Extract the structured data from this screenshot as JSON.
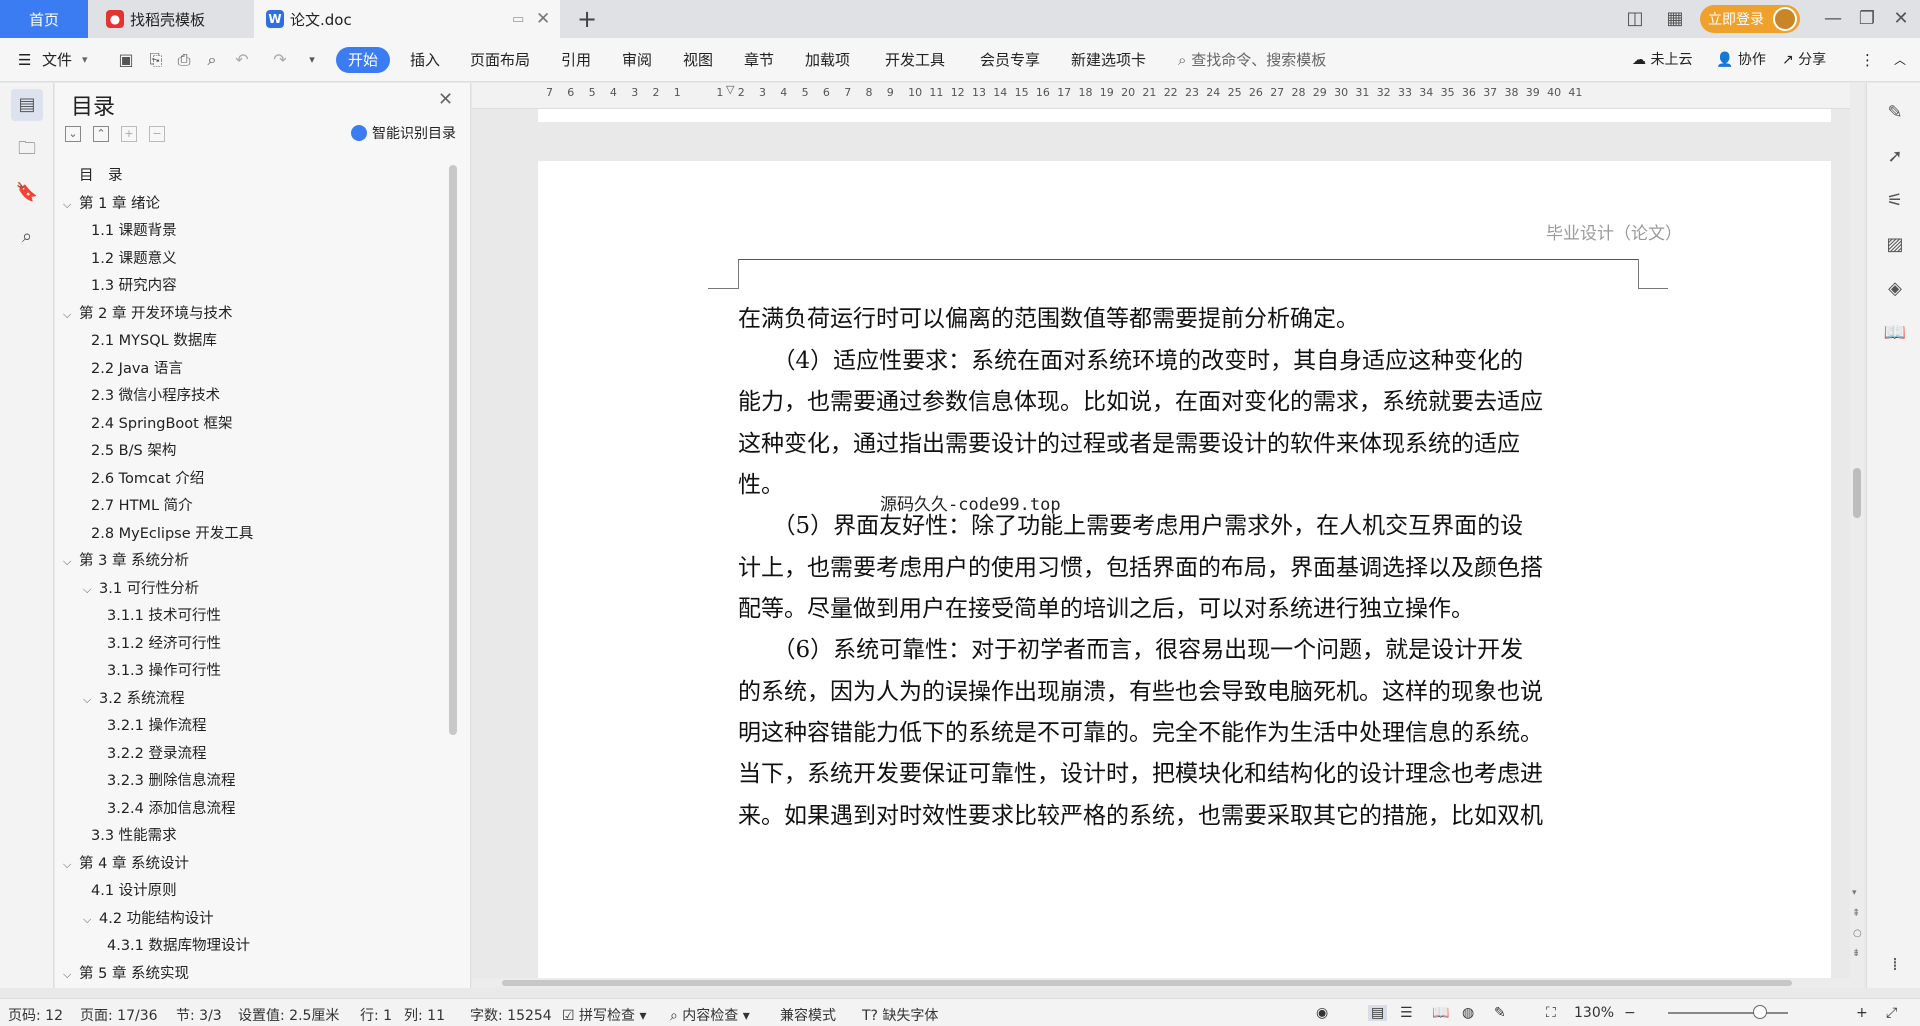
{
  "tabs": {
    "home": "首页",
    "template": "找稻壳模板",
    "document": "论文.doc",
    "add": "+"
  },
  "titlebar": {
    "login": "立即登录"
  },
  "toolbar": {
    "file": "文件",
    "items": [
      "开始",
      "插入",
      "页面布局",
      "引用",
      "审阅",
      "视图",
      "章节",
      "加载项",
      "开发工具",
      "会员专享",
      "新建选项卡"
    ],
    "search_placeholder": "查找命令、搜索模板",
    "cloud": "未上云",
    "collab": "协作",
    "share": "分享"
  },
  "toc": {
    "title": "目录",
    "ai_label": "智能识别目录",
    "items": [
      {
        "label": "目　录",
        "level": 0,
        "caret": ""
      },
      {
        "label": "第 1 章  绪论",
        "level": 0,
        "caret": "v"
      },
      {
        "label": "1.1  课题背景",
        "level": 1,
        "caret": ""
      },
      {
        "label": "1.2  课题意义",
        "level": 1,
        "caret": ""
      },
      {
        "label": "1.3  研究内容",
        "level": 1,
        "caret": ""
      },
      {
        "label": "第 2 章  开发环境与技术",
        "level": 0,
        "caret": "v"
      },
      {
        "label": "2.1 MYSQL 数据库",
        "level": 1,
        "caret": ""
      },
      {
        "label": "2.2 Java 语言",
        "level": 1,
        "caret": ""
      },
      {
        "label": "2.3  微信小程序技术",
        "level": 1,
        "caret": ""
      },
      {
        "label": "2.4 SpringBoot 框架",
        "level": 1,
        "caret": ""
      },
      {
        "label": "2.5 B/S 架构",
        "level": 1,
        "caret": ""
      },
      {
        "label": "2.6 Tomcat  介绍",
        "level": 1,
        "caret": ""
      },
      {
        "label": "2.7 HTML 简介",
        "level": 1,
        "caret": ""
      },
      {
        "label": "2.8 MyEclipse 开发工具",
        "level": 1,
        "caret": ""
      },
      {
        "label": "第 3 章  系统分析",
        "level": 0,
        "caret": "v"
      },
      {
        "label": "3.1  可行性分析",
        "level": 1,
        "caret": "v"
      },
      {
        "label": "3.1.1  技术可行性",
        "level": 2,
        "caret": ""
      },
      {
        "label": "3.1.2  经济可行性",
        "level": 2,
        "caret": ""
      },
      {
        "label": "3.1.3  操作可行性",
        "level": 2,
        "caret": ""
      },
      {
        "label": "3.2  系统流程",
        "level": 1,
        "caret": "v"
      },
      {
        "label": "3.2.1  操作流程",
        "level": 2,
        "caret": ""
      },
      {
        "label": "3.2.2  登录流程",
        "level": 2,
        "caret": ""
      },
      {
        "label": "3.2.3  删除信息流程",
        "level": 2,
        "caret": ""
      },
      {
        "label": "3.2.4  添加信息流程",
        "level": 2,
        "caret": ""
      },
      {
        "label": "3.3  性能需求",
        "level": 1,
        "caret": ""
      },
      {
        "label": "第 4 章  系统设计",
        "level": 0,
        "caret": "v"
      },
      {
        "label": "4.1  设计原则",
        "level": 1,
        "caret": ""
      },
      {
        "label": "4.2  功能结构设计",
        "level": 1,
        "caret": "v"
      },
      {
        "label": "4.3.1  数据库物理设计",
        "level": 2,
        "caret": ""
      },
      {
        "label": "第 5 章  系统实现",
        "level": 0,
        "caret": "v"
      }
    ]
  },
  "ruler": {
    "numbers": [
      "7",
      "6",
      "5",
      "4",
      "3",
      "2",
      "1",
      "",
      "1",
      "2",
      "3",
      "4",
      "5",
      "6",
      "7",
      "8",
      "9",
      "10",
      "11",
      "12",
      "13",
      "14",
      "15",
      "16",
      "17",
      "18",
      "19",
      "20",
      "21",
      "22",
      "23",
      "24",
      "25",
      "26",
      "27",
      "28",
      "29",
      "30",
      "31",
      "32",
      "33",
      "34",
      "35",
      "36",
      "37",
      "38",
      "39",
      "40",
      "41"
    ]
  },
  "document": {
    "header": "毕业设计（论文）",
    "watermark": "源码久久-code99.top",
    "lines": [
      "在满负荷运行时可以偏离的范围数值等都需要提前分析确定。",
      "　　（4）适应性要求：系统在面对系统环境的改变时，其自身适应这种变化的",
      "能力，也需要通过参数信息体现。比如说，在面对变化的需求，系统就要去适应",
      "这种变化，通过指出需要设计的过程或者是需要设计的软件来体现系统的适应",
      "性。",
      "　　（5）界面友好性：除了功能上需要考虑用户需求外，在人机交互界面的设",
      "计上，也需要考虑用户的使用习惯，包括界面的布局，界面基调选择以及颜色搭",
      "配等。尽量做到用户在接受简单的培训之后，可以对系统进行独立操作。",
      "　　（6）系统可靠性：对于初学者而言，很容易出现一个问题，就是设计开发",
      "的系统，因为人为的误操作出现崩溃，有些也会导致电脑死机。这样的现象也说",
      "明这种容错能力低下的系统是不可靠的。完全不能作为生活中处理信息的系统。",
      "当下，系统开发要保证可靠性，设计时，把模块化和结构化的设计理念也考虑进",
      "来。如果遇到对时效性要求比较严格的系统，也需要采取其它的措施，比如双机"
    ]
  },
  "status": {
    "page_code": "页码: 12",
    "page": "页面: 17/36",
    "section": "节: 3/3",
    "setting": "设置值: 2.5厘米",
    "row": "行: 1",
    "col": "列: 11",
    "words": "字数: 15254",
    "spell": "拼写检查",
    "content_check": "内容检查",
    "compat": "兼容模式",
    "missing_font": "缺失字体",
    "zoom": "130%"
  },
  "colors": {
    "accent": "#3b7cf3",
    "login": "#f0a12b"
  }
}
